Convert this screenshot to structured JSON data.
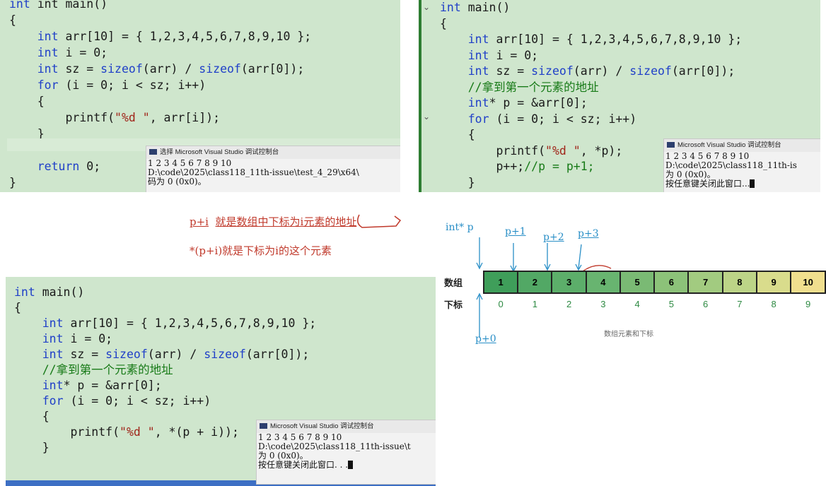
{
  "panel1": {
    "lines": [
      "int main()",
      "{",
      "    int arr[10] = { 1,2,3,4,5,6,7,8,9,10 };",
      "    int i = 0;",
      "    int sz = sizeof(arr) / sizeof(arr[0]);",
      "    for (i = 0; i < sz; i++)",
      "    {",
      "        printf(\"%d \", arr[i]);",
      "    }",
      "",
      "    return 0;",
      "}"
    ],
    "console": {
      "title": "选择 Microsoft Visual Studio 调试控制台",
      "lines": [
        "1 2 3 4 5 6 7 8 9 10",
        "D:\\code\\2025\\class118_11th-issue\\test_4_29\\x64\\",
        "码为 0 (0x0)。"
      ]
    }
  },
  "panel2": {
    "lines": [
      "int main()",
      "{",
      "    int arr[10] = { 1,2,3,4,5,6,7,8,9,10 };",
      "    int i = 0;",
      "    int sz = sizeof(arr) / sizeof(arr[0]);",
      "    //拿到第一个元素的地址",
      "    int* p = &arr[0];",
      "    for (i = 0; i < sz; i++)",
      "    {",
      "        printf(\"%d \", *p);",
      "        p++;//p = p+1;",
      "    }"
    ],
    "console": {
      "title": "Microsoft Visual Studio 调试控制台",
      "lines": [
        "1 2 3 4 5 6 7 8 9 10",
        "D:\\code\\2025\\class118_11th-is",
        "为 0 (0x0)。",
        "按任意键关闭此窗口..."
      ]
    }
  },
  "captions": {
    "line1_a": "p+i",
    "line1_b": "就是数组中下标为i元素的地址",
    "line2": "*(p+i)就是下标为i的这个元素"
  },
  "panel3": {
    "lines": [
      "int main()",
      "{",
      "    int arr[10] = { 1,2,3,4,5,6,7,8,9,10 };",
      "    int i = 0;",
      "    int sz = sizeof(arr) / sizeof(arr[0]);",
      "    //拿到第一个元素的地址",
      "    int* p = &arr[0];",
      "    for (i = 0; i < sz; i++)",
      "    {",
      "        printf(\"%d \", *(p + i));",
      "    }"
    ],
    "console": {
      "title": "Microsoft Visual Studio 调试控制台",
      "lines": [
        "1 2 3 4 5 6 7 8 9 10",
        "D:\\code\\2025\\class118_11th-issue\\t",
        "为 0 (0x0)。",
        "按任意键关闭此窗口. . ."
      ]
    }
  },
  "diagram": {
    "pointer_labels": [
      "int* p",
      "p+1",
      "p+2",
      "p+3",
      "p+0"
    ],
    "row_label_array": "数组",
    "row_label_index": "下标",
    "elements": [
      "1",
      "2",
      "3",
      "4",
      "5",
      "6",
      "7",
      "8",
      "9",
      "10"
    ],
    "indices": [
      "0",
      "1",
      "2",
      "3",
      "4",
      "5",
      "6",
      "7",
      "8",
      "9"
    ],
    "caption": "数组元素和下标",
    "cell_colors": [
      "#3f9e5a",
      "#52a865",
      "#5cae6a",
      "#68b470",
      "#7aba74",
      "#8cc279",
      "#a2cb80",
      "#bcd487",
      "#d9dc8c",
      "#f0df8e"
    ]
  }
}
